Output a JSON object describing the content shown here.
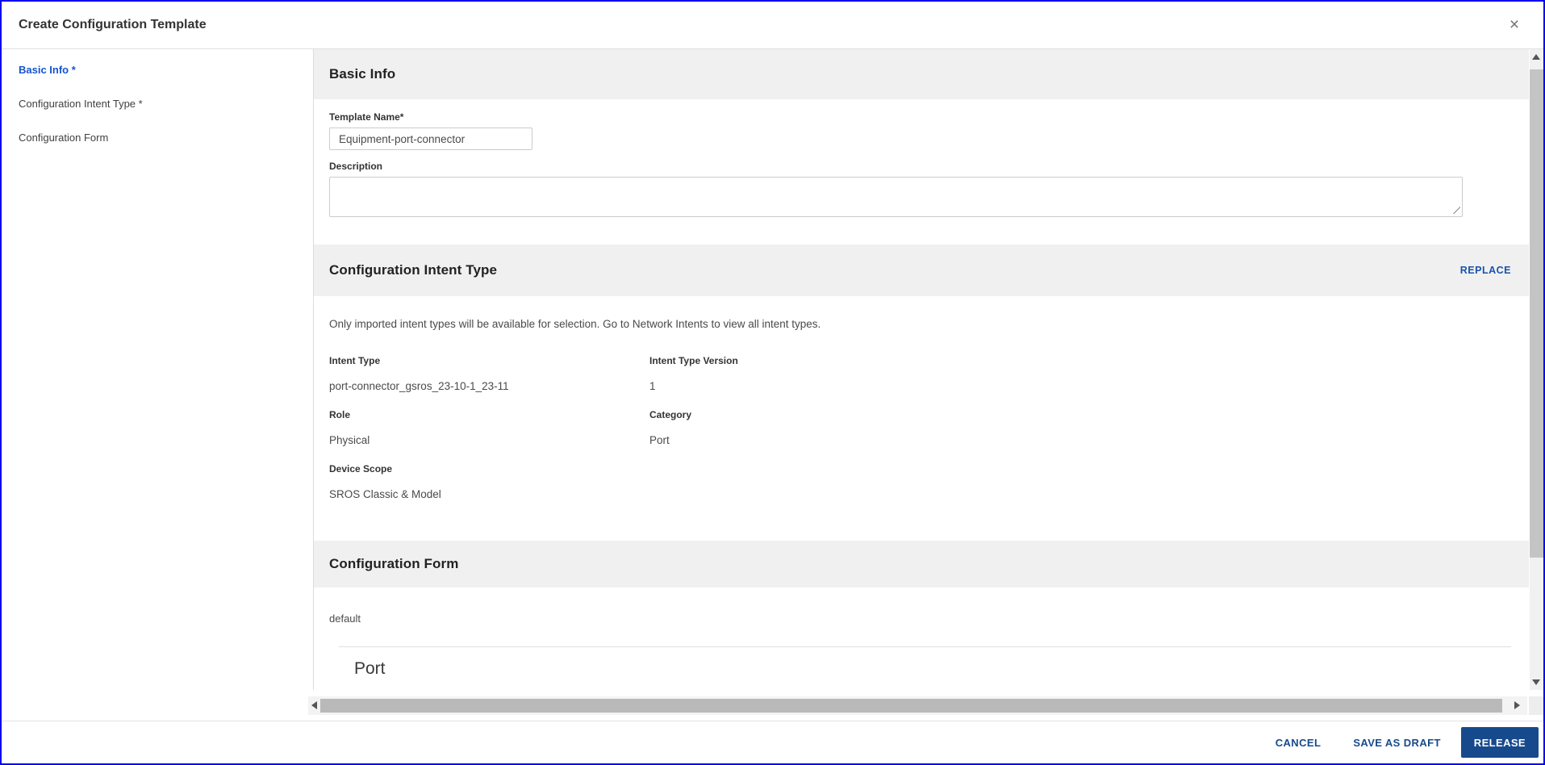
{
  "window": {
    "title": "Create Configuration Template",
    "close_icon": "×"
  },
  "sidebar": {
    "items": [
      {
        "label": "Basic Info *",
        "active": true
      },
      {
        "label": "Configuration Intent Type *",
        "active": false
      },
      {
        "label": "Configuration Form",
        "active": false
      }
    ]
  },
  "basic_info": {
    "section_title": "Basic Info",
    "template_name_label": "Template Name*",
    "template_name_value": "Equipment-port-connector",
    "description_label": "Description",
    "description_value": ""
  },
  "intent_type_section": {
    "section_title": "Configuration Intent Type",
    "replace_label": "REPLACE",
    "info_text": "Only imported intent types will be available for selection. Go to Network Intents to view all intent types.",
    "fields": [
      {
        "label": "Intent Type",
        "value": "port-connector_gsros_23-10-1_23-11"
      },
      {
        "label": "Intent Type Version",
        "value": "1"
      },
      {
        "label": "Role",
        "value": "Physical"
      },
      {
        "label": "Category",
        "value": "Port"
      },
      {
        "label": "Device Scope",
        "value": "SROS Classic & Model"
      }
    ]
  },
  "config_form_section": {
    "section_title": "Configuration Form",
    "selected_form": "default",
    "form_heading": "Port"
  },
  "footer": {
    "cancel_label": "CANCEL",
    "save_draft_label": "SAVE AS DRAFT",
    "release_label": "RELEASE"
  },
  "colors": {
    "window_border": "#0004f0",
    "active_step_blue": "#1353cf",
    "replace_link_blue": "#1a52ad",
    "footer_link_blue": "#174a8c",
    "release_button_bg": "#174a8c",
    "section_band_gray": "#f0f0f0"
  }
}
